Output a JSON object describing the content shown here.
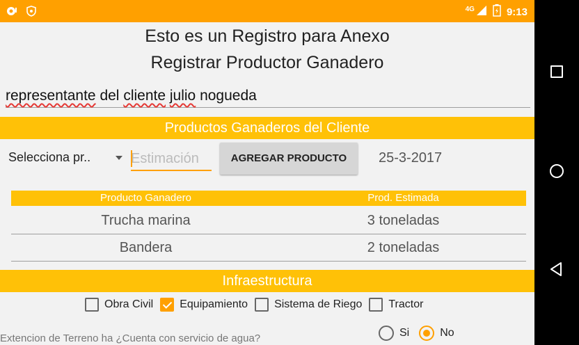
{
  "status_bar": {
    "network": "4G",
    "time": "9:13",
    "icons": [
      "notification-icon",
      "shield-icon",
      "signal-icon",
      "battery-icon"
    ]
  },
  "header": {
    "line1": "Esto es un Registro para Anexo",
    "line2": "Registrar Productor Ganadero"
  },
  "client_field": {
    "word1": "representante",
    "word2": "del",
    "word3": "cliente",
    "word4": "julio",
    "word5": "nogueda"
  },
  "products_section": {
    "title": "Productos Ganaderos del Cliente",
    "spinner_value": "Selecciona pr..",
    "estimate_placeholder": "Estimación",
    "add_button": "AGREGAR PRODUCTO",
    "date": "25-3-2017",
    "table": {
      "headers": [
        "Producto Ganadero",
        "Prod. Estimada"
      ],
      "rows": [
        [
          "Trucha marina",
          "3 toneladas"
        ],
        [
          "Bandera",
          "2 toneladas"
        ]
      ]
    }
  },
  "infra_section": {
    "title": "Infraestructura",
    "options": [
      {
        "label": "Obra Civil",
        "checked": false
      },
      {
        "label": "Equipamiento",
        "checked": true
      },
      {
        "label": "Sistema de Riego",
        "checked": false
      },
      {
        "label": "Tractor",
        "checked": false
      }
    ],
    "bottom_text": "Extencion de Terreno          ha   ¿Cuenta con servicio de agua?",
    "radio": [
      {
        "label": "Si",
        "selected": false
      },
      {
        "label": "No",
        "selected": true
      }
    ]
  },
  "colors": {
    "status_bar": "#ffa000",
    "section_bar": "#ffc107",
    "accent": "#ffa000"
  }
}
